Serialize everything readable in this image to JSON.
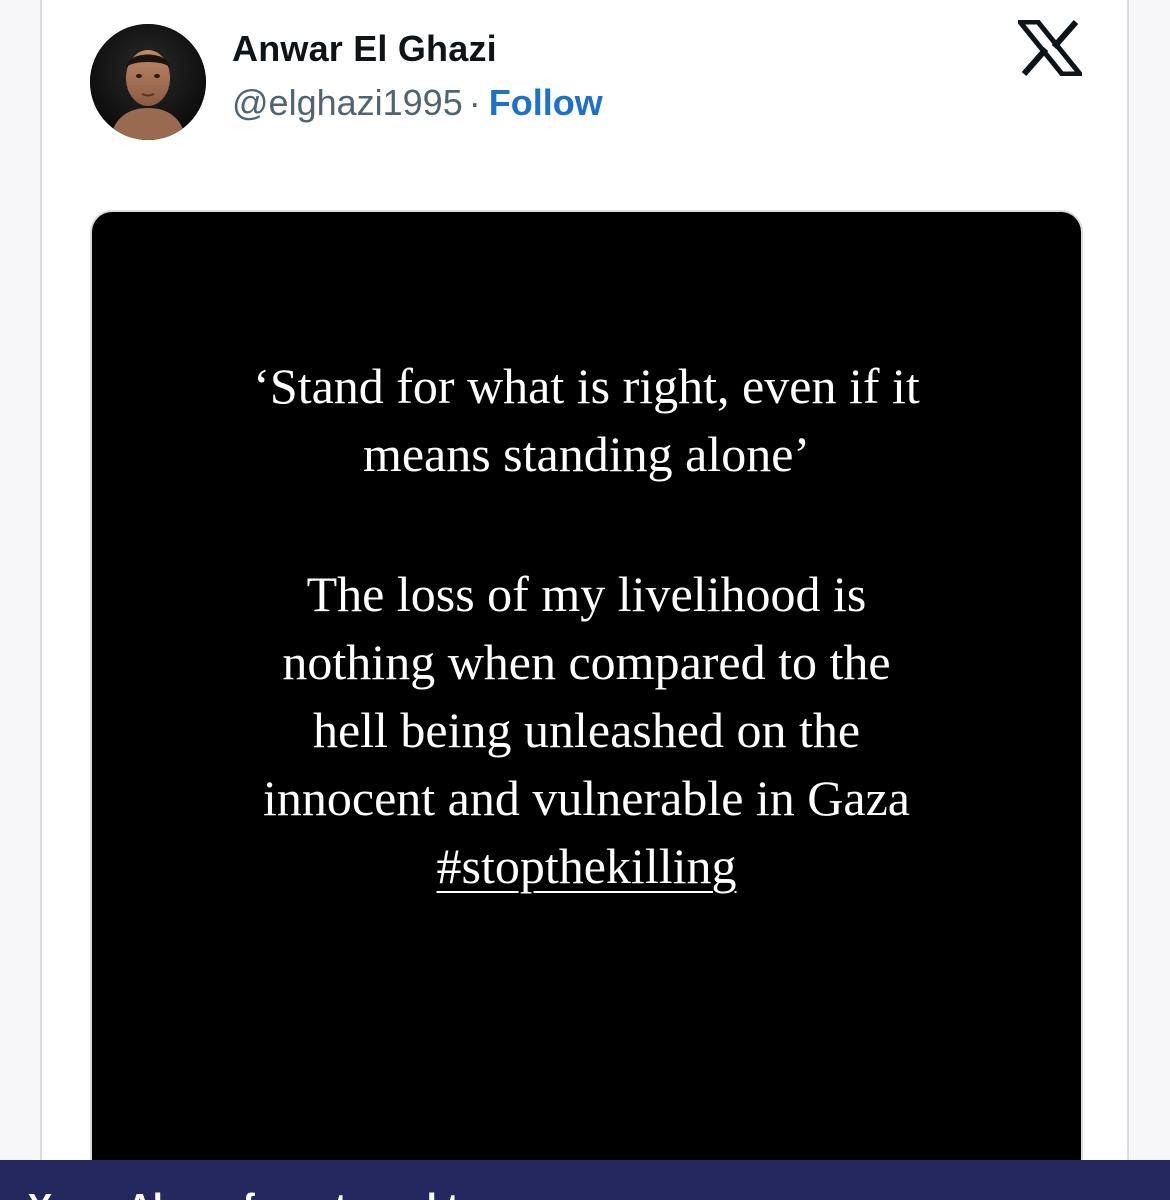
{
  "tweet": {
    "author_name": "Anwar El Ghazi",
    "handle": "@elghazi1995",
    "separator": "·",
    "follow_label": "Follow",
    "platform_icon": "x-logo-icon",
    "avatar_icon": "profile-photo"
  },
  "media": {
    "quote_lines": [
      "‘Stand for what is right, even if it",
      "means standing alone’"
    ],
    "body_lines": [
      "The loss of my livelihood is",
      "nothing when compared to the",
      "hell being unleashed on the",
      "innocent and vulnerable in Gaza"
    ],
    "hashtag": "#stopthekilling"
  },
  "banner": {
    "text": "Y...  ...  Al...  ...  f...  ...  t...  ...  l  t..."
  },
  "colors": {
    "follow": "#1d72c8",
    "banner_bg": "#25285e",
    "media_bg": "#000000"
  }
}
